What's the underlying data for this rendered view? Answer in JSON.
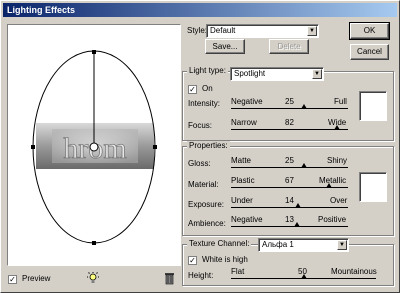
{
  "window": {
    "title": "Lighting Effects"
  },
  "style": {
    "label": "Style:",
    "value": "Default",
    "save": "Save...",
    "delete": "Delete"
  },
  "buttons": {
    "ok": "OK",
    "cancel": "Cancel"
  },
  "light": {
    "group_label": "Light type:",
    "type_value": "Spotlight",
    "on_label": "On",
    "on_checked": true,
    "intensity": {
      "label": "Intensity:",
      "min": "Negative",
      "value": "25",
      "max": "Full",
      "level": 0.625
    },
    "focus": {
      "label": "Focus:",
      "min": "Narrow",
      "value": "82",
      "max": "Wide",
      "level": 0.91
    }
  },
  "properties": {
    "group_label": "Properties:",
    "gloss": {
      "label": "Gloss:",
      "min": "Matte",
      "value": "25",
      "max": "Shiny",
      "level": 0.625
    },
    "material": {
      "label": "Material:",
      "min": "Plastic",
      "value": "67",
      "max": "Metallic",
      "level": 0.835
    },
    "exposure": {
      "label": "Exposure:",
      "min": "Under",
      "value": "14",
      "max": "Over",
      "level": 0.57
    },
    "ambience": {
      "label": "Ambience:",
      "min": "Negative",
      "value": "13",
      "max": "Positive",
      "level": 0.565
    }
  },
  "texture": {
    "channel_label": "Texture Channel:",
    "channel_value": "Альфа 1",
    "white_is_high_label": "White is high",
    "white_is_high_checked": true,
    "height": {
      "label": "Height:",
      "min": "Flat",
      "value": "50",
      "max": "Mountainous",
      "level": 0.5
    }
  },
  "preview": {
    "label": "Preview",
    "checked": true,
    "image_text": "hrom"
  },
  "icons": {
    "light_bulb": "light-bulb-icon",
    "trash": "trash-icon"
  }
}
